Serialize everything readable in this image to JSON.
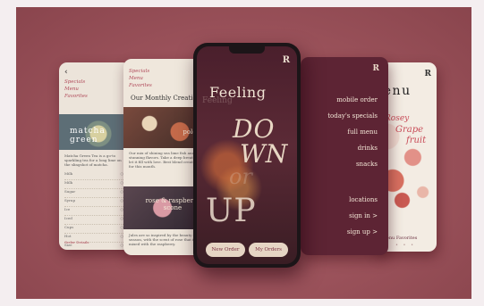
{
  "colors": {
    "background": "#a8545e",
    "accent": "#b04a5a",
    "menu_bg": "#5d2434"
  },
  "phone_left": {
    "back_icon": "chevron-left-icon",
    "nav": [
      "Specials",
      "Menu",
      "Favorites"
    ],
    "photo_label": "matcha green",
    "paragraph": "Matcha Green Tea is a go-to sparkling tea for a long lime on the slingshot of matcha.",
    "rows": [
      "Milk",
      "Milk",
      "Sugar",
      "Syrup",
      "Ice",
      "Iced",
      "Cups",
      "Hot",
      "Size"
    ],
    "footer": "Order Details"
  },
  "phone_second": {
    "nav": [
      "Specials",
      "Menu",
      "Favorites"
    ],
    "heading": "Our Monthly Creations",
    "image1_label": "polenta",
    "paragraph1": "Our mix of shining sea lime fish and stunning flavors. Take a deep breath and let it fill with love. Best blend creations for this month.",
    "image2_label": "rose & raspberry scone",
    "paragraph2": "Jules are so inspired by the beauty of the season, with the scent of rose that is mixed with the raspberry."
  },
  "phone_center": {
    "logo": "R",
    "feeling": "Feeling",
    "down_part1": "DO",
    "down_part2": "WN",
    "or": "or",
    "up": "UP",
    "button_new_order": "New Order",
    "button_my_orders": "My Orders"
  },
  "phone_menu": {
    "logo": "R",
    "items_top": [
      "mobile order",
      "today's specials",
      "full menu",
      "drinks",
      "snacks"
    ],
    "items_bottom": [
      "locations",
      "sign in  >",
      "sign up  >"
    ]
  },
  "phone_right": {
    "logo": "R",
    "title": "menu",
    "feature_line1": "Rosey",
    "feature_line2": "Grape",
    "feature_line3": "fruit",
    "tabs": "als  Menu  Favorites",
    "dots": "• • •"
  }
}
